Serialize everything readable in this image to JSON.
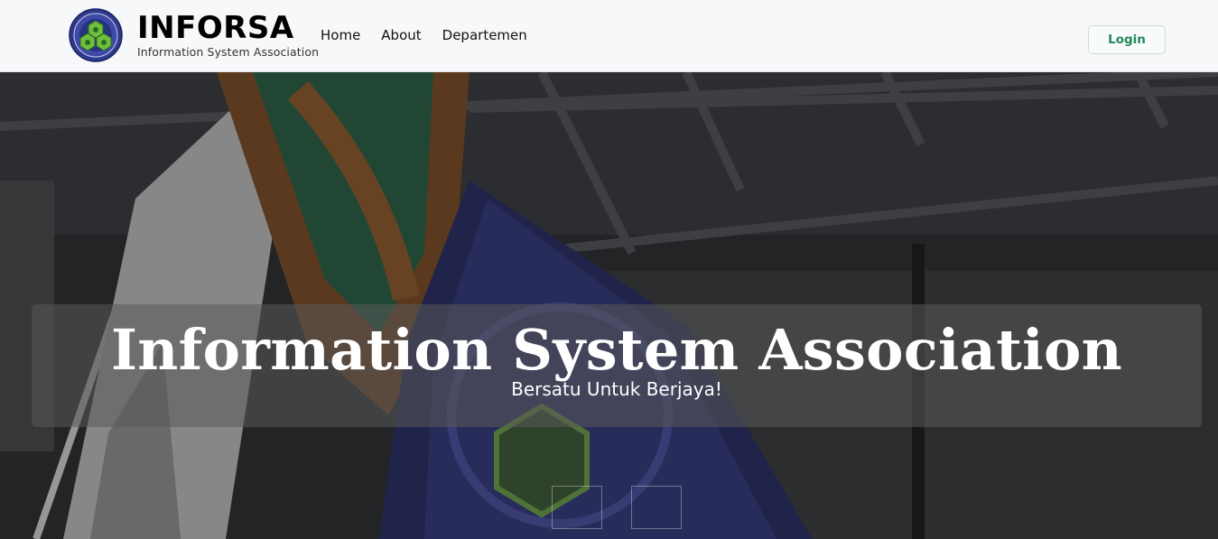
{
  "navbar": {
    "brand_title": "INFORSA",
    "brand_subtitle": "Information System Association",
    "links": [
      "Home",
      "About",
      "Departemen"
    ],
    "login_label": "Login",
    "accent_color": "#1f8a5a"
  },
  "hero": {
    "title": "Information System Association",
    "subtitle": "Bersatu Untuk Berjaya!",
    "carousel_indicator_count": 2
  },
  "icons": {
    "logo": "inforsa-logo-emblem"
  }
}
